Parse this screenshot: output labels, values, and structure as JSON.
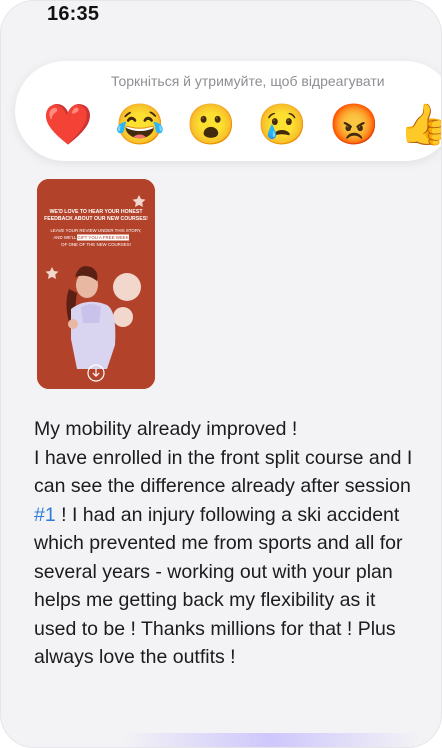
{
  "status_bar": {
    "time": "16:35"
  },
  "reaction_bar": {
    "hint": "Торкніться й утримуйте, щоб відреагувати",
    "reactions": [
      {
        "name": "heart",
        "glyph": "❤️"
      },
      {
        "name": "joy",
        "glyph": "😂"
      },
      {
        "name": "surprised",
        "glyph": "😮"
      },
      {
        "name": "sad",
        "glyph": "😢"
      },
      {
        "name": "angry",
        "glyph": "😡"
      },
      {
        "name": "thumbs-up",
        "glyph": "👍"
      }
    ]
  },
  "story_preview": {
    "headline": "WE'D LOVE TO HEAR YOUR HONEST FEEDBACK ABOUT OUR NEW COURSES!",
    "body_line1": "LEAVE YOUR REVIEW UNDER THIS STORY,",
    "body_line2_a": "AND WE'LL",
    "body_highlight": "GIFT YOU A FREE WEEK",
    "body_line3": "OF ONE OF THE NEW COURSES!",
    "download_glyph": "↓",
    "colors": {
      "background": "#b2432a",
      "highlight": "#ffffff"
    }
  },
  "message": {
    "line1": "My mobility already improved !",
    "part1": "I have enrolled in the front split course and I can see the difference already after session ",
    "hashtag": "#1",
    "part2": " ! I had an injury following a ski accident which prevented me from sports and all for several years - working out with your plan helps me getting back my flexibility as it used to be ! Thanks millions for that ! Plus always love the outfits !"
  }
}
